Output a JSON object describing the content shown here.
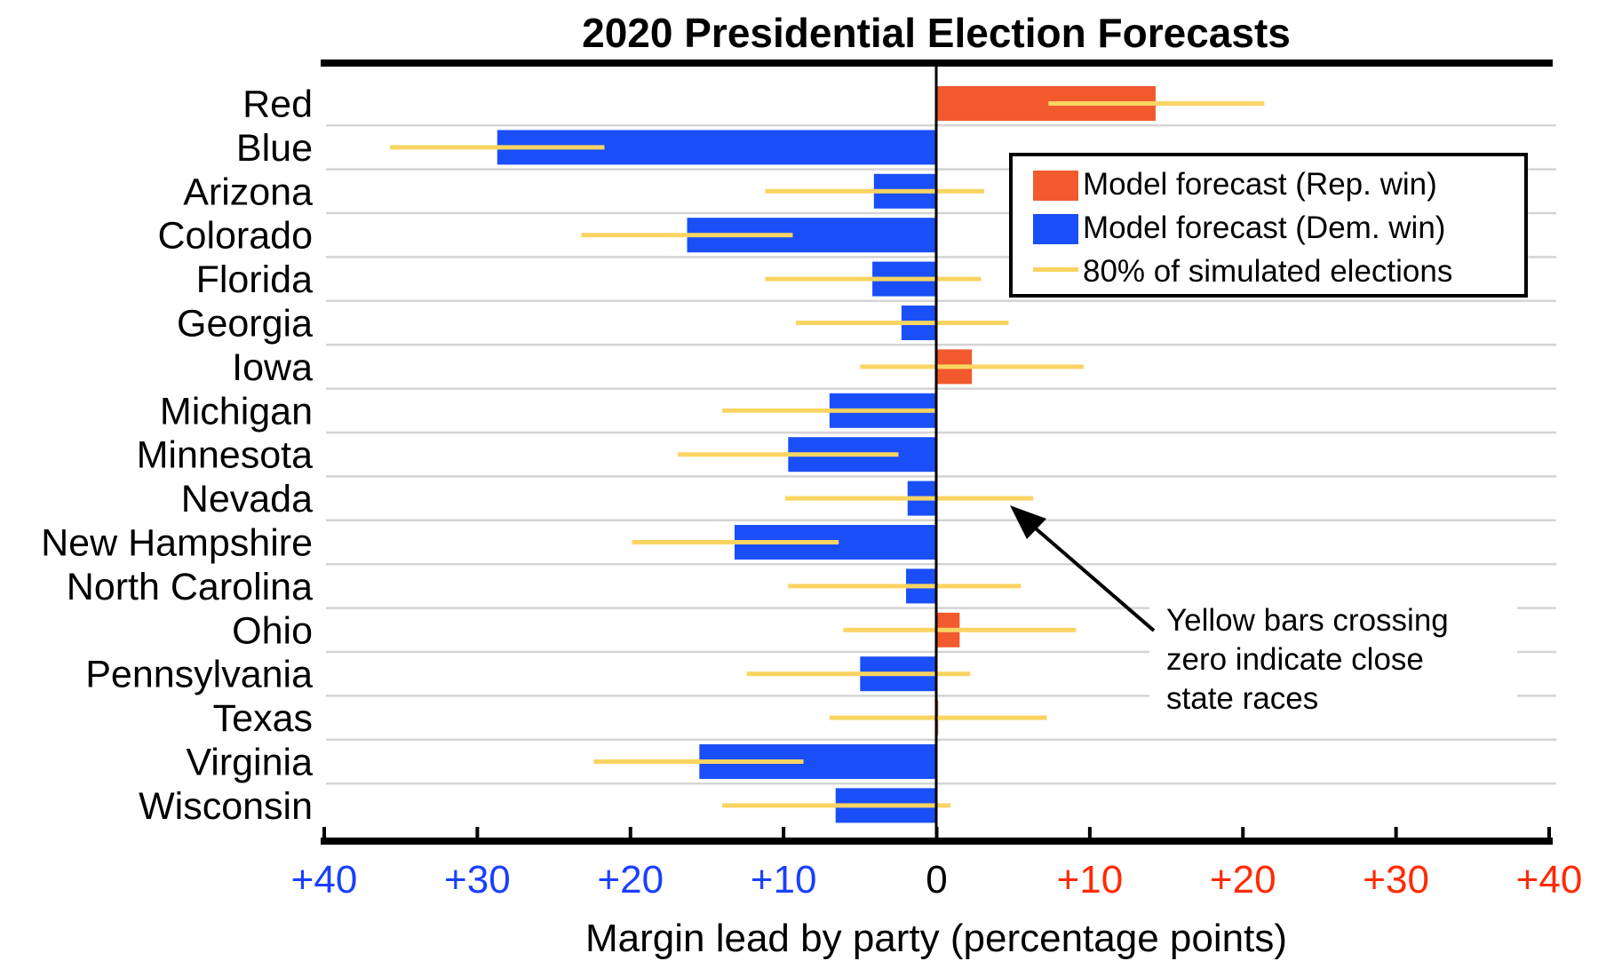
{
  "chart_data": {
    "type": "bar",
    "orientation": "horizontal",
    "title": "2020 Presidential Election Forecasts",
    "xlabel": "Margin lead by party (percentage points)",
    "ylabel": "",
    "xlim": [
      -40,
      40
    ],
    "x_ticks": [
      {
        "value": -40,
        "label": "+40",
        "color": "#1a3fff"
      },
      {
        "value": -30,
        "label": "+30",
        "color": "#1a3fff"
      },
      {
        "value": -20,
        "label": "+20",
        "color": "#1a3fff"
      },
      {
        "value": -10,
        "label": "+10",
        "color": "#1a3fff"
      },
      {
        "value": 0,
        "label": "0",
        "color": "#000000"
      },
      {
        "value": 10,
        "label": "+10",
        "color": "#ff2a00"
      },
      {
        "value": 20,
        "label": "+20",
        "color": "#ff2a00"
      },
      {
        "value": 30,
        "label": "+30",
        "color": "#ff2a00"
      },
      {
        "value": 40,
        "label": "+40",
        "color": "#ff2a00"
      }
    ],
    "sign_convention": "negative = Democratic lead, positive = Republican lead",
    "grid": "horizontal row separators",
    "legend_position": "top-right",
    "legend": [
      {
        "label": "Model forecast (Rep. win)",
        "kind": "bar",
        "color": "#f25a2e"
      },
      {
        "label": "Model forecast (Dem. win)",
        "kind": "bar",
        "color": "#1a4ff8"
      },
      {
        "label": "80% of simulated elections",
        "kind": "line",
        "color": "#fad462"
      }
    ],
    "colors": {
      "rep": "#f25a2e",
      "dem": "#1a4ff8",
      "interval": "#fad462",
      "grid": "#d4d4d4"
    },
    "categories": [
      "Red",
      "Blue",
      "Arizona",
      "Colorado",
      "Florida",
      "Georgia",
      "Iowa",
      "Michigan",
      "Minnesota",
      "Nevada",
      "New Hampshire",
      "North Carolina",
      "Ohio",
      "Pennsylvania",
      "Texas",
      "Virginia",
      "Wisconsin"
    ],
    "series": [
      {
        "name": "Model forecast margin",
        "values": [
          14.3,
          -28.7,
          -4.1,
          -16.3,
          -4.2,
          -2.3,
          2.3,
          -7.0,
          -9.7,
          -1.9,
          -13.2,
          -2.0,
          1.5,
          -5.0,
          0.1,
          -15.5,
          -6.6
        ]
      },
      {
        "name": "80% of simulated elections (low)",
        "values": [
          7.3,
          -35.7,
          -11.2,
          -23.2,
          -11.2,
          -9.2,
          -5.0,
          -14.0,
          -16.9,
          -9.9,
          -19.9,
          -9.7,
          -6.1,
          -12.4,
          -7.0,
          -22.4,
          -14.0
        ]
      },
      {
        "name": "80% of simulated elections (high)",
        "values": [
          21.4,
          -21.7,
          3.1,
          -9.4,
          2.9,
          4.7,
          9.6,
          0.0,
          -2.5,
          6.3,
          -6.4,
          5.5,
          9.1,
          2.2,
          7.2,
          -8.7,
          0.9
        ]
      }
    ],
    "annotation": {
      "lines": [
        "Yellow bars crossing",
        "zero indicate close",
        "state races"
      ],
      "arrow_target": {
        "x": 5.0,
        "category": "Nevada"
      }
    }
  }
}
